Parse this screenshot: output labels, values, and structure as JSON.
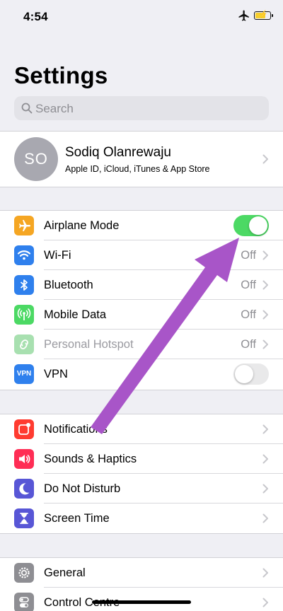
{
  "status_bar": {
    "time": "4:54",
    "airplane_icon": "airplane-icon",
    "battery_icon": "battery-charging-icon"
  },
  "title": "Settings",
  "search": {
    "placeholder": "Search",
    "icon": "search-icon"
  },
  "profile": {
    "initials": "SO",
    "name": "Sodiq Olanrewaju",
    "subtitle": "Apple ID, iCloud, iTunes & App Store"
  },
  "connectivity": [
    {
      "label": "Airplane Mode",
      "icon": "airplane-icon",
      "color": "#f5a623",
      "control": "toggle",
      "toggle_on": true
    },
    {
      "label": "Wi-Fi",
      "icon": "wifi-icon",
      "color": "#2f80ed",
      "value": "Off"
    },
    {
      "label": "Bluetooth",
      "icon": "bluetooth-icon",
      "color": "#2f80ed",
      "value": "Off"
    },
    {
      "label": "Mobile Data",
      "icon": "antenna-icon",
      "color": "#4cd964",
      "value": "Off"
    },
    {
      "label": "Personal Hotspot",
      "icon": "hotspot-icon",
      "color": "#a8e0b0",
      "value": "Off",
      "dimmed": true
    },
    {
      "label": "VPN",
      "icon": "vpn-icon",
      "icon_text": "VPN",
      "color": "#2f80ed",
      "control": "toggle",
      "toggle_on": false
    }
  ],
  "notifications_group": [
    {
      "label": "Notifications",
      "icon": "notifications-icon",
      "color": "#ff3b30"
    },
    {
      "label": "Sounds & Haptics",
      "icon": "speaker-icon",
      "color": "#ff2d55"
    },
    {
      "label": "Do Not Disturb",
      "icon": "moon-icon",
      "color": "#5856d6"
    },
    {
      "label": "Screen Time",
      "icon": "hourglass-icon",
      "color": "#5856d6"
    }
  ],
  "general_group": [
    {
      "label": "General",
      "icon": "gear-icon",
      "color": "#8e8e93"
    },
    {
      "label": "Control Centre",
      "icon": "switches-icon",
      "color": "#8e8e93"
    }
  ],
  "annotation": {
    "icon": "arrow-annotation-icon",
    "color": "#a855c8"
  }
}
